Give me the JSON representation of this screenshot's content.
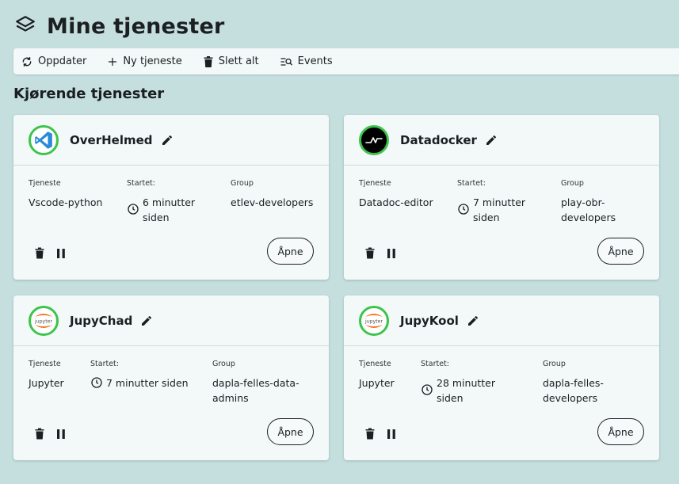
{
  "page_title": "Mine tjenester",
  "toolbar": {
    "refresh_label": "Oppdater",
    "new_label": "Ny tjeneste",
    "delete_all_label": "Slett alt",
    "events_label": "Events"
  },
  "section_title": "Kjørende tjenester",
  "labels": {
    "service": "Tjeneste",
    "started": "Startet:",
    "group": "Group",
    "open": "Åpne"
  },
  "colors": {
    "accent_green": "#3cc44a",
    "background": "#c5dfdf",
    "card": "#f3f8f8"
  },
  "services": [
    {
      "name": "OverHelmed",
      "icon": "vscode-icon",
      "service": "Vscode-python",
      "started": "6 minutter siden",
      "group": "etlev-developers"
    },
    {
      "name": "Datadocker",
      "icon": "datadoc-icon",
      "service": "Datadoc-editor",
      "started": "7 minutter siden",
      "group": "play-obr-developers"
    },
    {
      "name": "JupyChad",
      "icon": "jupyter-icon",
      "service": "Jupyter",
      "started": "7 minutter siden",
      "group": "dapla-felles-data-admins"
    },
    {
      "name": "JupyKool",
      "icon": "jupyter-icon",
      "service": "Jupyter",
      "started": "28 minutter siden",
      "group": "dapla-felles-developers"
    }
  ]
}
